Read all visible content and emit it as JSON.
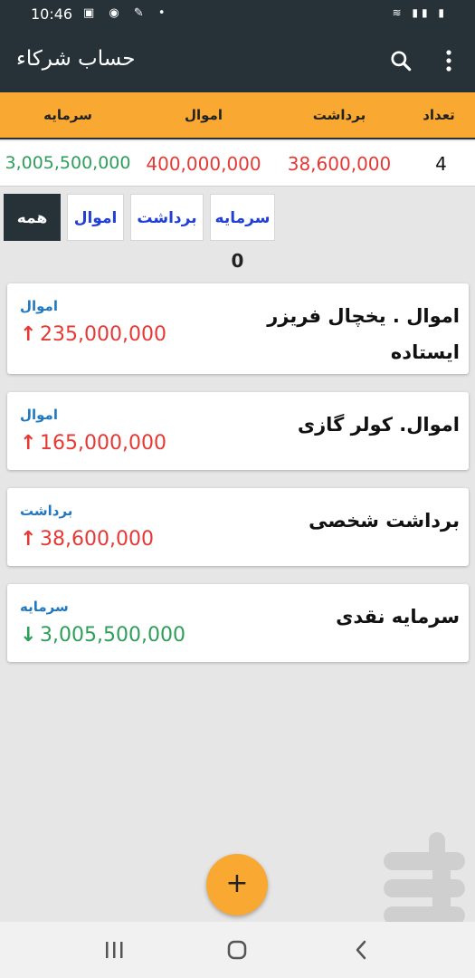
{
  "status": {
    "time": "10:46"
  },
  "app_bar": {
    "title": "حساب شرکاء"
  },
  "summary": {
    "headers": {
      "capital": "سرمایه",
      "assets": "اموال",
      "withdraw": "برداشت",
      "count": "تعداد"
    },
    "values": {
      "capital": "3,005,500,000",
      "assets": "400,000,000",
      "withdraw": "38,600,000",
      "count": "4"
    }
  },
  "filters": {
    "all": "همه",
    "assets": "اموال",
    "withdraw": "برداشت",
    "capital": "سرمایه"
  },
  "count_label": "0",
  "transactions": [
    {
      "title": "اموال . یخچال فریزر ایستاده",
      "type": "اموال",
      "amount": "235,000,000",
      "arrow": "↑"
    },
    {
      "title": "اموال. کولر گازی",
      "type": "اموال",
      "amount": "165,000,000",
      "arrow": "↑"
    },
    {
      "title": "برداشت شخصی",
      "type": "برداشت",
      "amount": "38,600,000",
      "arrow": "↑"
    },
    {
      "title": "سرمایه نقدی",
      "type": "سرمایه",
      "amount": "3,005,500,000",
      "arrow": "↓"
    }
  ],
  "fab": {
    "label": "+"
  },
  "colors": {
    "accent": "#f9a832",
    "dark": "#263238",
    "red": "#e53935",
    "green": "#2e9e5b",
    "blue": "#1f78c2"
  }
}
